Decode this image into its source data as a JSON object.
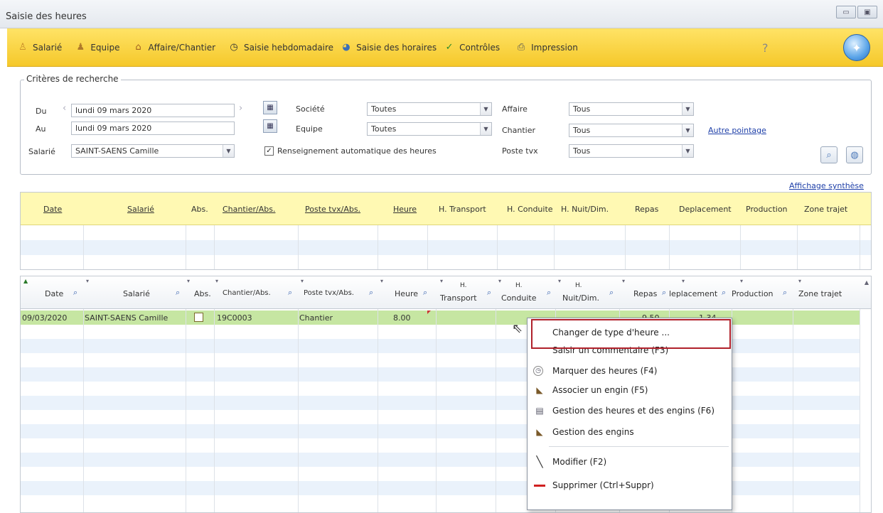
{
  "window": {
    "title": "Saisie des heures"
  },
  "toolbar": {
    "items": [
      {
        "label": "Salarié",
        "icon": "person-icon"
      },
      {
        "label": "Equipe",
        "icon": "team-icon"
      },
      {
        "label": "Affaire/Chantier",
        "icon": "building-icon"
      },
      {
        "label": "Saisie hebdomadaire",
        "icon": "clock-icon"
      },
      {
        "label": "Saisie des horaires",
        "icon": "pie-icon"
      },
      {
        "label": "Contrôles",
        "icon": "checkmark-icon"
      },
      {
        "label": "Impression",
        "icon": "printer-icon"
      }
    ]
  },
  "criteria": {
    "legend": "Critères de recherche",
    "du_label": "Du",
    "du_value": "lundi 09 mars 2020",
    "au_label": "Au",
    "au_value": "lundi 09 mars 2020",
    "salarie_label": "Salarié",
    "salarie_value": "SAINT-SAENS Camille",
    "societe_label": "Société",
    "societe_value": "Toutes",
    "equipe_label": "Equipe",
    "equipe_value": "Toutes",
    "auto_label": "Renseignement automatique des heures",
    "auto_checked": "✓",
    "affaire_label": "Affaire",
    "affaire_value": "Tous",
    "chantier_label": "Chantier",
    "chantier_value": "Tous",
    "poste_label": "Poste tvx",
    "poste_value": "Tous",
    "autre_pointage": "Autre pointage"
  },
  "affichage_synthese": "Affichage synthèse",
  "grid1": {
    "columns": [
      "Date",
      "Salarié",
      "Abs.",
      "Chantier/Abs.",
      "Poste tvx/Abs.",
      "Heure",
      "H. Transport",
      "H. Conduite",
      "H. Nuit/Dim.",
      "Repas",
      "Deplacement",
      "Production",
      "Zone trajet"
    ]
  },
  "grid2": {
    "columns": {
      "date": "Date",
      "salarie": "Salarié",
      "abs": "Abs.",
      "chantier": "Chantier/Abs.",
      "poste": "Poste tvx/Abs.",
      "heure": "Heure",
      "h1": "H.",
      "transport": "Transport",
      "h2": "H.",
      "conduite": "Conduite",
      "h3": "H.",
      "nuit": "Nuit/Dim.",
      "repas": "Repas",
      "deplacement": "leplacement",
      "production": "Production",
      "zone": "Zone trajet"
    },
    "row": {
      "date": "09/03/2020",
      "salarie": "SAINT-SAENS Camille",
      "chantier": "19C0003",
      "poste": "Chantier",
      "heure": "8.00",
      "repas": "9.50",
      "deplacement": "1.34"
    }
  },
  "context_menu": {
    "items": [
      {
        "label": "Changer de type d'heure ...",
        "icon": ""
      },
      {
        "label": "Saisir un commentaire (F3)",
        "icon": ""
      },
      {
        "label": "Marquer des heures (F4)",
        "icon": "marker-icon"
      },
      {
        "label": "Associer un engin (F5)",
        "icon": "machine-icon"
      },
      {
        "label": "Gestion des heures et des engins (F6)",
        "icon": "clipboard-icon"
      },
      {
        "label": "Gestion des engins",
        "icon": "machine-icon"
      },
      {
        "label": "Modifier (F2)",
        "icon": "pencil-icon"
      },
      {
        "label": "Supprimer (Ctrl+Suppr)",
        "icon": "delete-icon"
      }
    ]
  },
  "colors": {
    "toolbar": "#f5c82a",
    "header_yellow": "#fff9b3",
    "selected_row": "#c6e6a2",
    "highlight_border": "#b0212b",
    "link": "#1e3fa8"
  }
}
